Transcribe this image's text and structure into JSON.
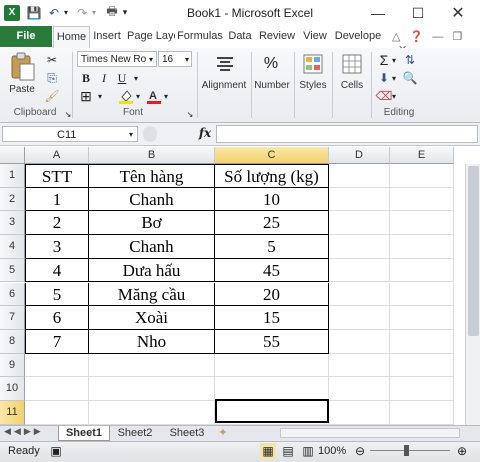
{
  "window": {
    "title": "Book1 - Microsoft Excel"
  },
  "tabs": [
    "File",
    "Home",
    "Insert",
    "Page Layo",
    "Formulas",
    "Data",
    "Review",
    "View",
    "Develope"
  ],
  "ribbon": {
    "paste": "Paste",
    "clipboard": "Clipboard",
    "font_name": "Times New Ro",
    "font_size": "16",
    "font": "Font",
    "bold": "B",
    "italic": "I",
    "underline": "U",
    "alignment": "Alignment",
    "number": "Number",
    "number_symbol": "%",
    "styles": "Styles",
    "cells": "Cells",
    "editing": "Editing"
  },
  "formula_bar": {
    "name_box": "C11",
    "fx": "fx",
    "value": ""
  },
  "columns": [
    "A",
    "B",
    "C",
    "D",
    "E"
  ],
  "rows": [
    "1",
    "2",
    "3",
    "4",
    "5",
    "6",
    "7",
    "8",
    "9",
    "10",
    "11"
  ],
  "table": {
    "header": [
      "STT",
      "Tên hàng",
      "Số lượng (kg)"
    ],
    "data": [
      [
        "1",
        "Chanh",
        "10"
      ],
      [
        "2",
        "Bơ",
        "25"
      ],
      [
        "3",
        "Chanh",
        "5"
      ],
      [
        "4",
        "Dưa hấu",
        "45"
      ],
      [
        "5",
        "Măng cầu",
        "20"
      ],
      [
        "6",
        "Xoài",
        "15"
      ],
      [
        "7",
        "Nho",
        "55"
      ]
    ]
  },
  "sheets": [
    "Sheet1",
    "Sheet2",
    "Sheet3"
  ],
  "status": {
    "ready": "Ready",
    "zoom": "100%"
  }
}
